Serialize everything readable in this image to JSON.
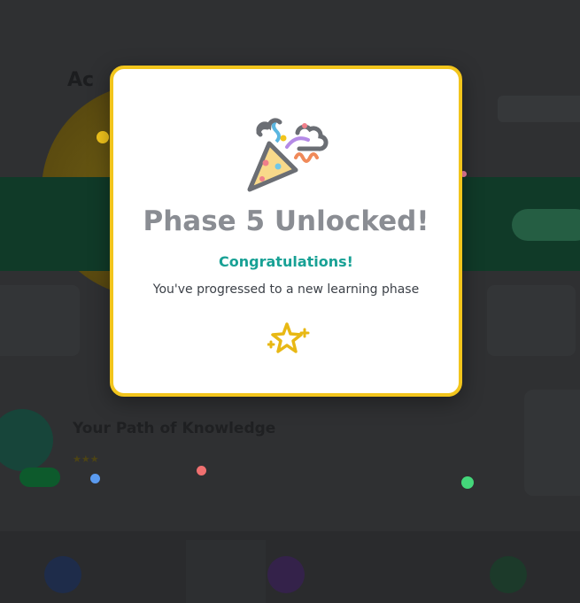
{
  "modal": {
    "title": "Phase 5 Unlocked!",
    "subtitle": "Congratulations!",
    "message": "You've progressed to a new learning phase",
    "icon": "party-popper-icon",
    "sparkle_icon": "sparkles-icon"
  },
  "background": {
    "heading": "Ac",
    "achievement_title": "Your Path of Knowledge",
    "colors": {
      "modal_border": "#f2c51c",
      "title": "#8a8d93",
      "subtitle": "#18a195",
      "message": "#3c4148"
    }
  },
  "confetti_colors": [
    "#f2c51c",
    "#5b9bf0",
    "#f07070",
    "#44d67a",
    "#f07fa0"
  ]
}
